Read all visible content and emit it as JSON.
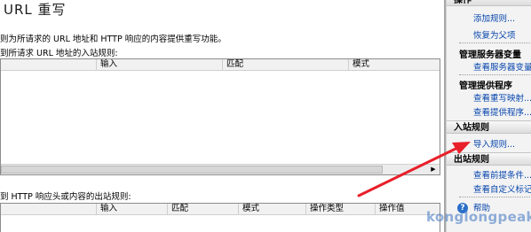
{
  "page_title": "URL 重写",
  "description": "则为所请求的 URL 地址和 HTTP 响应的内容提供重写功能。",
  "inbound": {
    "label": "到所请求 URL 地址的入站规则:",
    "columns": [
      "",
      "输入",
      "匹配",
      "模式"
    ]
  },
  "outbound": {
    "label": "到 HTTP 响应头或内容的出站规则:",
    "columns": [
      "",
      "输入",
      "匹配",
      "模式",
      "操作类型",
      "操作值"
    ]
  },
  "actions": {
    "header": "操作",
    "add_rule": "添加规则...",
    "revert_parent": "恢复为父项",
    "manage_server_vars": "管理服务器变量",
    "view_server_vars": "查看服务器变量...",
    "manage_providers": "管理提供程序",
    "view_rewrite_maps": "查看重写映射...",
    "view_providers": "查看提供程序...",
    "inbound_header": "入站规则",
    "import_rules": "导入规则...",
    "outbound_header": "出站规则",
    "view_preconditions": "查看前提条件...",
    "view_custom_tags": "查看自定义标记...",
    "help": "帮助"
  },
  "watermark": "konglongpeak",
  "colors": {
    "arrow": "#e8202a",
    "link": "#0645ad",
    "watermark": "#4f81c7"
  }
}
